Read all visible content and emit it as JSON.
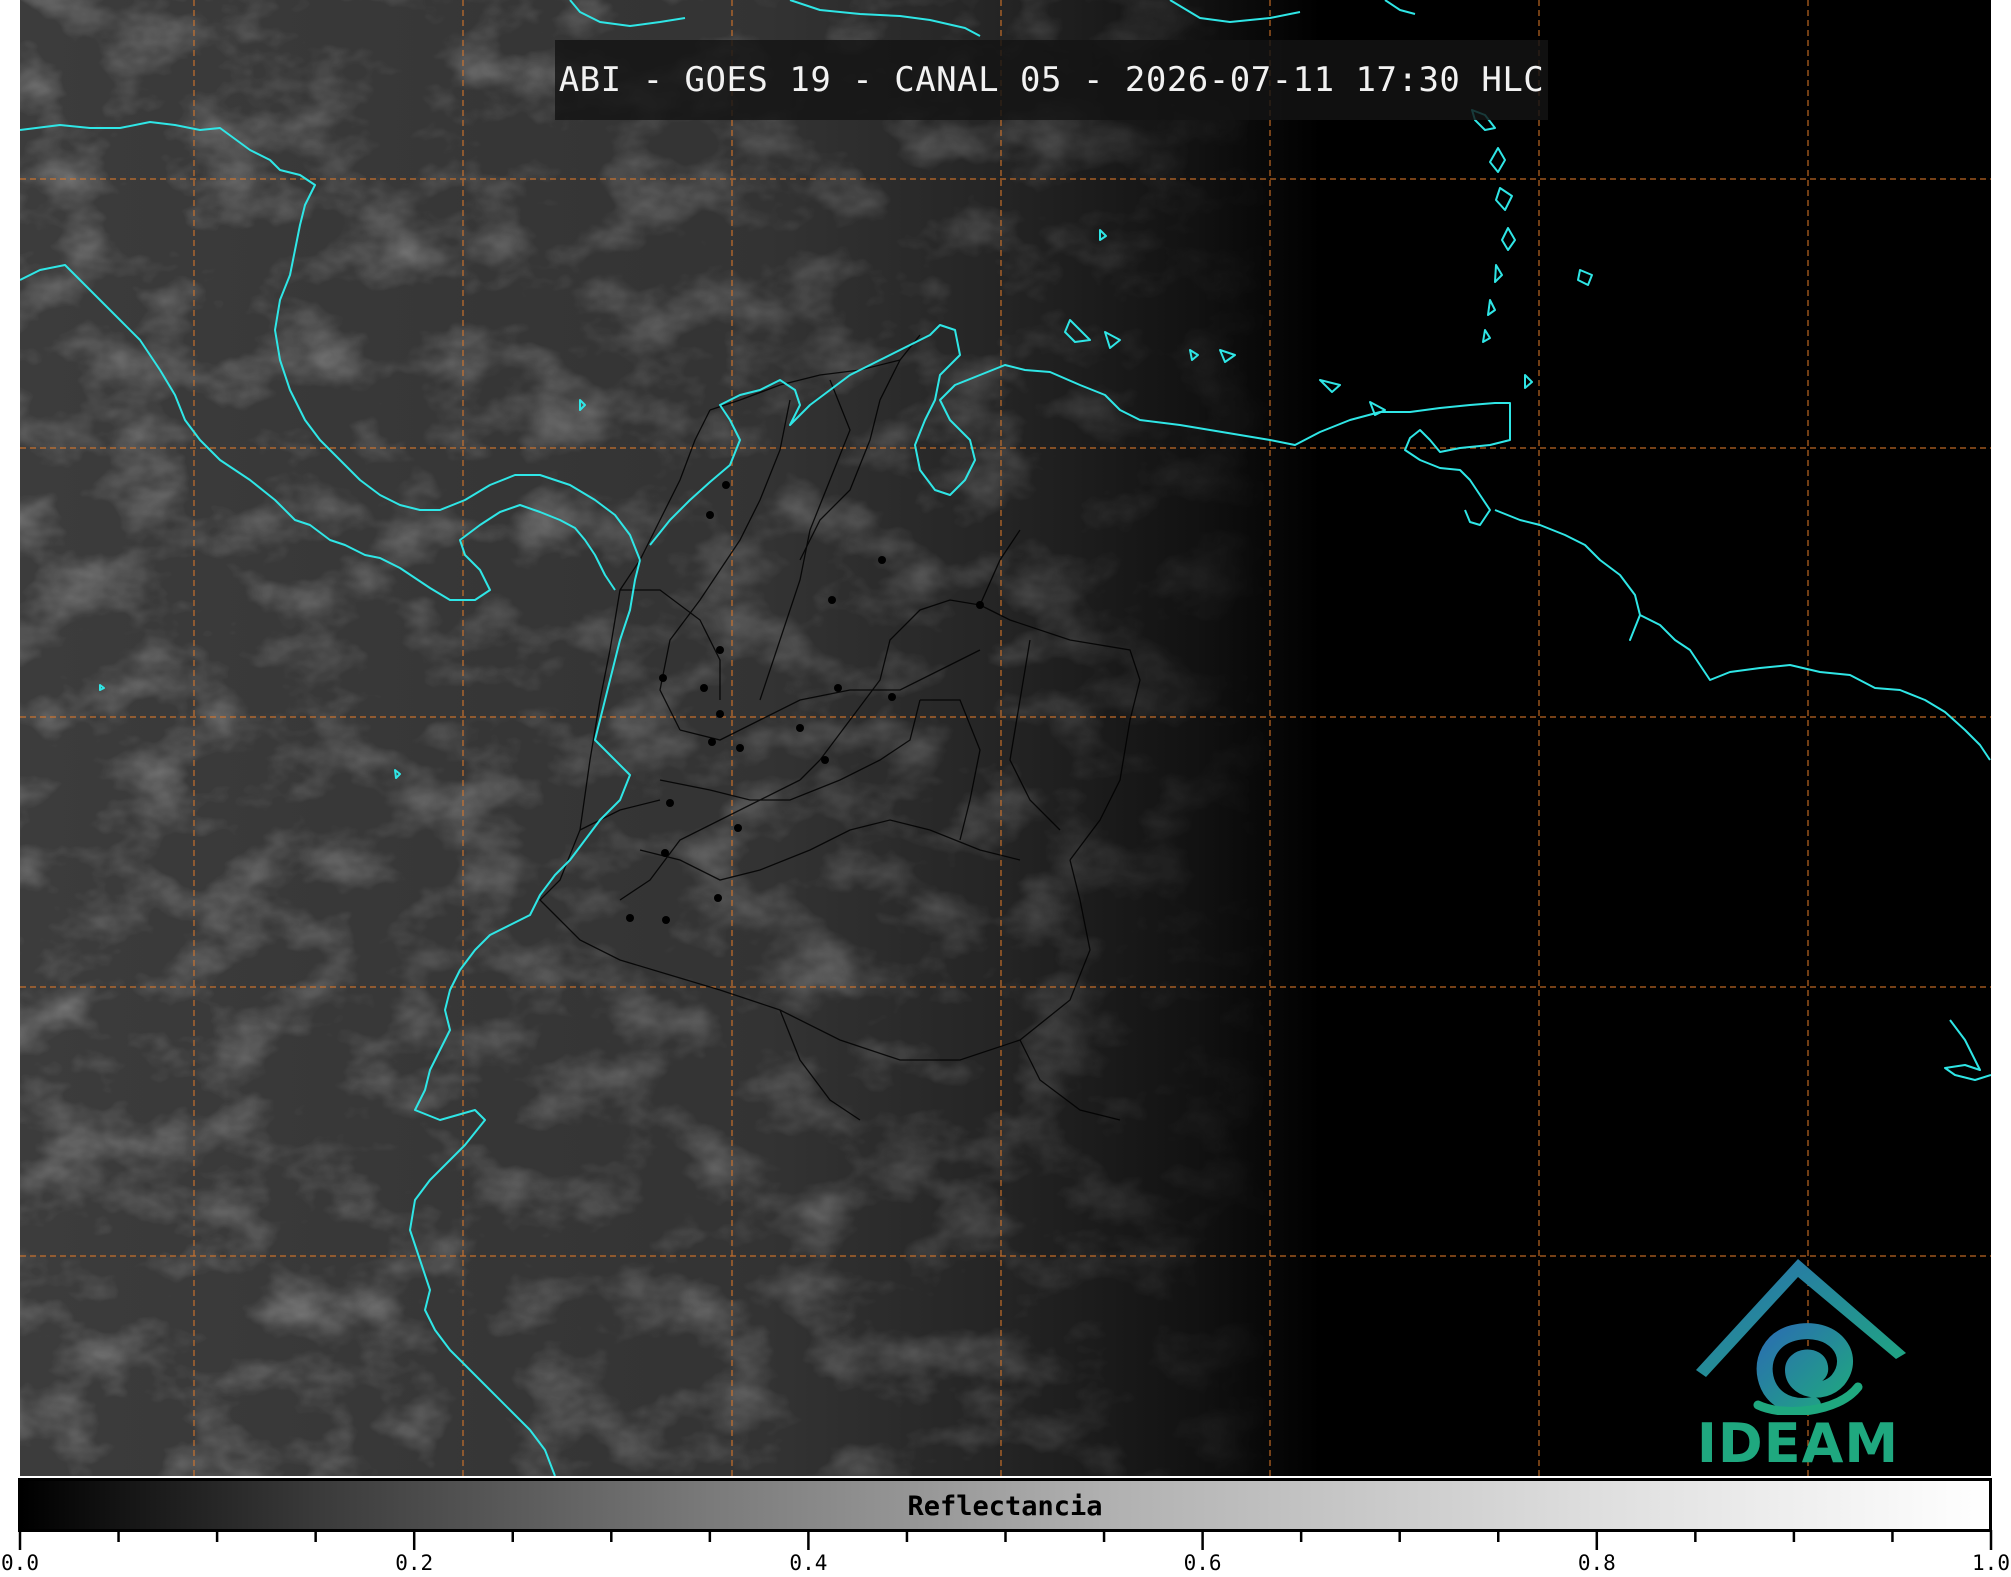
{
  "title": "ABI - GOES 19 - CANAL 05 - 2026-07-11 17:30 HLC",
  "colorbar": {
    "label": "Reflectancia",
    "range": [
      0.0,
      1.0
    ],
    "major_ticks": [
      0.0,
      0.2,
      0.4,
      0.6,
      0.8,
      1.0
    ],
    "tick_labels": [
      "0.0",
      "0.2",
      "0.4",
      "0.6",
      "0.8",
      "1.0"
    ],
    "minor_step": 0.05,
    "colormap": [
      "#000000",
      "#ffffff"
    ]
  },
  "logo": {
    "text": "IDEAM"
  },
  "colors": {
    "coastline": "#2fe6e6",
    "graticule": "#e07a2a",
    "borders": "#000000",
    "logo_green": "#1fa87f",
    "logo_blue": "#2a6fb0"
  },
  "map": {
    "graticule": "dashed",
    "layers": [
      "coastlines",
      "departmental-borders",
      "city-markers"
    ]
  }
}
